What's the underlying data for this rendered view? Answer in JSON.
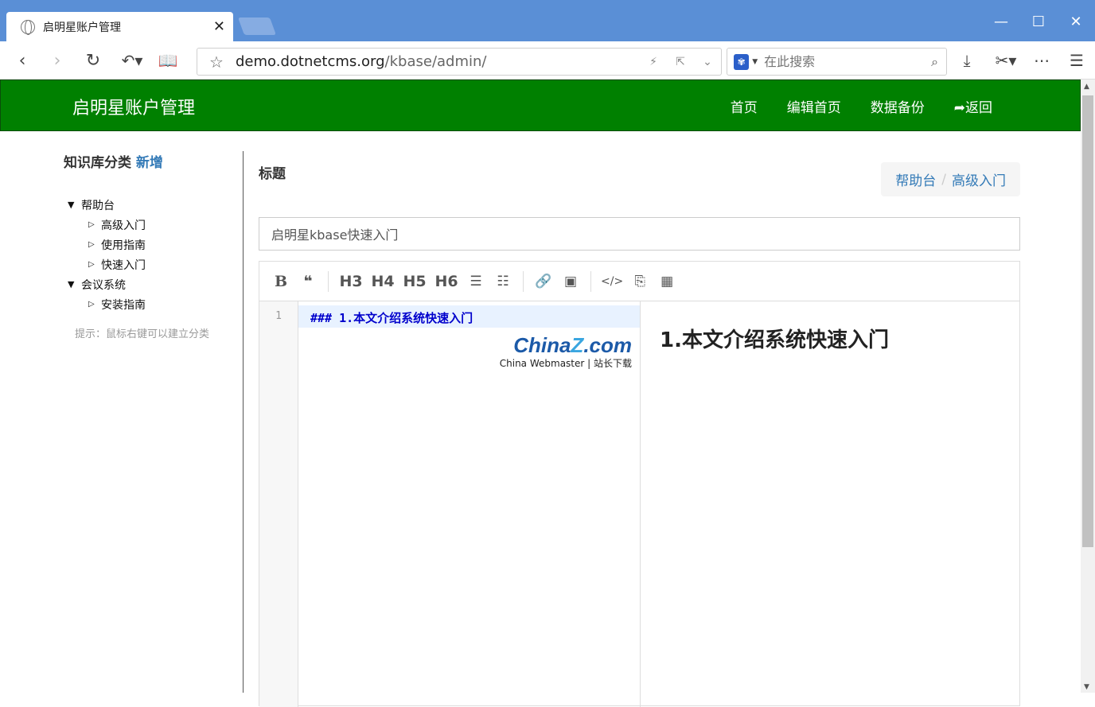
{
  "browser": {
    "tab_title": "启明星账户管理",
    "url_host": "demo.dotnetcms.org",
    "url_path": "/kbase/admin/",
    "search_placeholder": "在此搜索"
  },
  "navbar": {
    "brand": "启明星账户管理",
    "links": [
      "首页",
      "编辑首页",
      "数据备份",
      "➦返回"
    ]
  },
  "sidebar": {
    "heading": "知识库分类",
    "add_label": "新增",
    "tree": [
      {
        "label": "帮助台",
        "children": [
          "高级入门",
          "使用指南",
          "快速入门"
        ]
      },
      {
        "label": "会议系统",
        "children": [
          "安装指南"
        ]
      }
    ],
    "hint": "提示：鼠标右键可以建立分类"
  },
  "main": {
    "title_label": "标题",
    "breadcrumb": [
      "帮助台",
      "高级入门"
    ],
    "title_value": "启明星kbase快速入门"
  },
  "editor": {
    "toolbar": {
      "bold": "B",
      "quote": "❝",
      "h3": "H3",
      "h4": "H4",
      "h5": "H5",
      "h6": "H6",
      "ul": "☰",
      "ol": "☷",
      "link": "🔗",
      "image": "▣",
      "code": "</>",
      "codeblock": "⎘",
      "table": "▦"
    },
    "line_number": "1",
    "source_line": "### 1.本文介绍系统快速入门",
    "preview_heading": "1.本文介绍系统快速入门"
  },
  "watermark": {
    "brand_a": "China",
    "brand_z": "Z",
    "brand_b": ".com",
    "tagline": "China Webmaster | 站长下载"
  }
}
